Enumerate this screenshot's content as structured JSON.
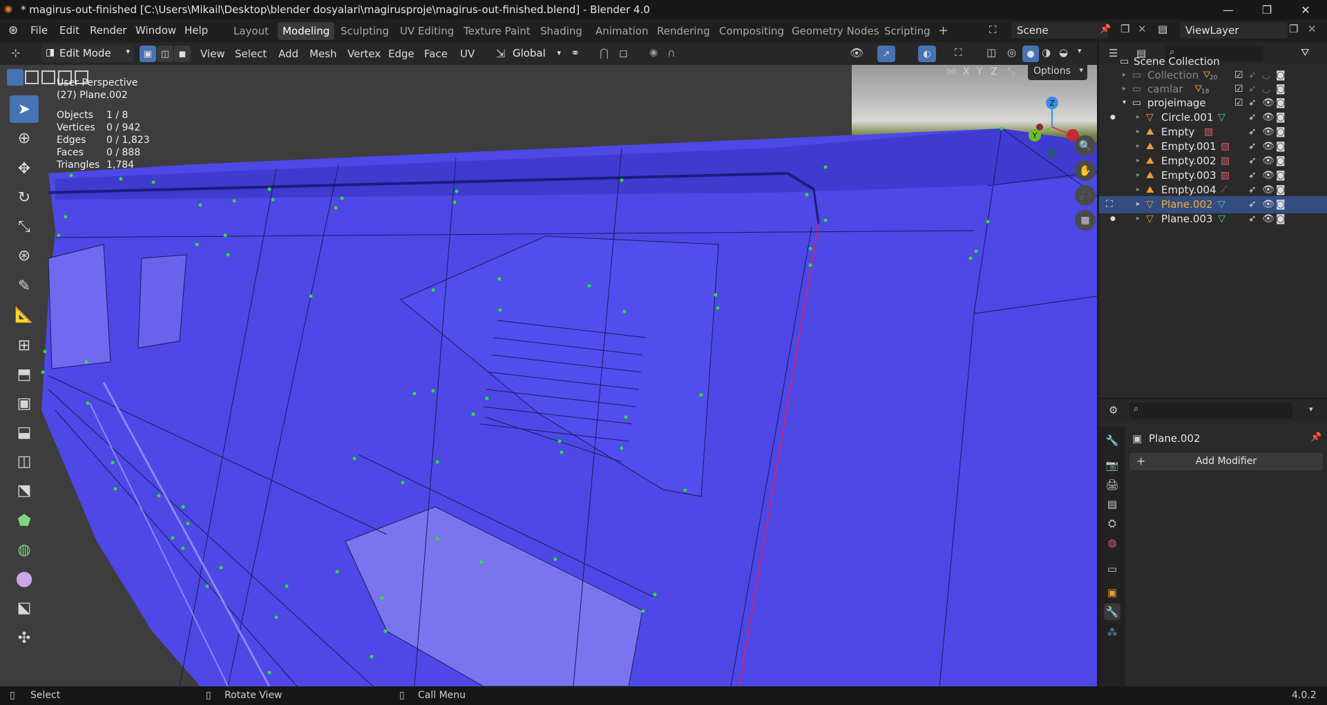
{
  "window": {
    "title": "* magirus-out-finished [C:\\Users\\Mikail\\Desktop\\blender dosyalari\\magirusproje\\magirus-out-finished.blend] - Blender 4.0"
  },
  "menu": [
    "File",
    "Edit",
    "Render",
    "Window",
    "Help"
  ],
  "workspace_tabs": [
    "Layout",
    "Modeling",
    "Sculpting",
    "UV Editing",
    "Texture Paint",
    "Shading",
    "Animation",
    "Rendering",
    "Compositing",
    "Geometry Nodes",
    "Scripting"
  ],
  "active_workspace": "Modeling",
  "scene_name": "Scene",
  "view_layer": "ViewLayer",
  "header": {
    "mode": "Edit Mode",
    "menus": [
      "View",
      "Select",
      "Add",
      "Mesh",
      "Vertex",
      "Edge",
      "Face",
      "UV"
    ],
    "transform_orientation": "Global",
    "options_label": "Options",
    "axes": [
      "X",
      "Y",
      "Z"
    ]
  },
  "viewport": {
    "perspective": "User Perspective",
    "object": "(27) Plane.002",
    "stats": [
      {
        "label": "Objects",
        "value": "1 / 8"
      },
      {
        "label": "Vertices",
        "value": "0 / 942"
      },
      {
        "label": "Edges",
        "value": "0 / 1,823"
      },
      {
        "label": "Faces",
        "value": "0 / 888"
      },
      {
        "label": "Triangles",
        "value": "1,784"
      }
    ],
    "gizmo_axes": {
      "z": "Z",
      "y": "Y"
    }
  },
  "outliner": {
    "root": "Scene Collection",
    "rows": [
      {
        "name": "Collection",
        "count": "20",
        "dim": true
      },
      {
        "name": "camlar",
        "count": "18",
        "dim": true
      },
      {
        "name": "projeimage",
        "dim": false
      },
      {
        "name": "Circle.001",
        "type": "mesh"
      },
      {
        "name": "Empty",
        "type": "empty"
      },
      {
        "name": "Empty.001",
        "type": "empty"
      },
      {
        "name": "Empty.002",
        "type": "empty"
      },
      {
        "name": "Empty.003",
        "type": "empty"
      },
      {
        "name": "Empty.004",
        "type": "empty"
      },
      {
        "name": "Plane.002",
        "type": "mesh",
        "selected": true
      },
      {
        "name": "Plane.003",
        "type": "mesh"
      }
    ]
  },
  "properties": {
    "object": "Plane.002",
    "add_modifier": "Add Modifier"
  },
  "status": {
    "select": "Select",
    "rotate": "Rotate View",
    "call_menu": "Call Menu",
    "version": "4.0.2"
  },
  "colors": {
    "mesh_face": "#4d48e6",
    "vertex": "#22e82c",
    "accent": "#4772b3",
    "highlight": "#ffaf29"
  }
}
